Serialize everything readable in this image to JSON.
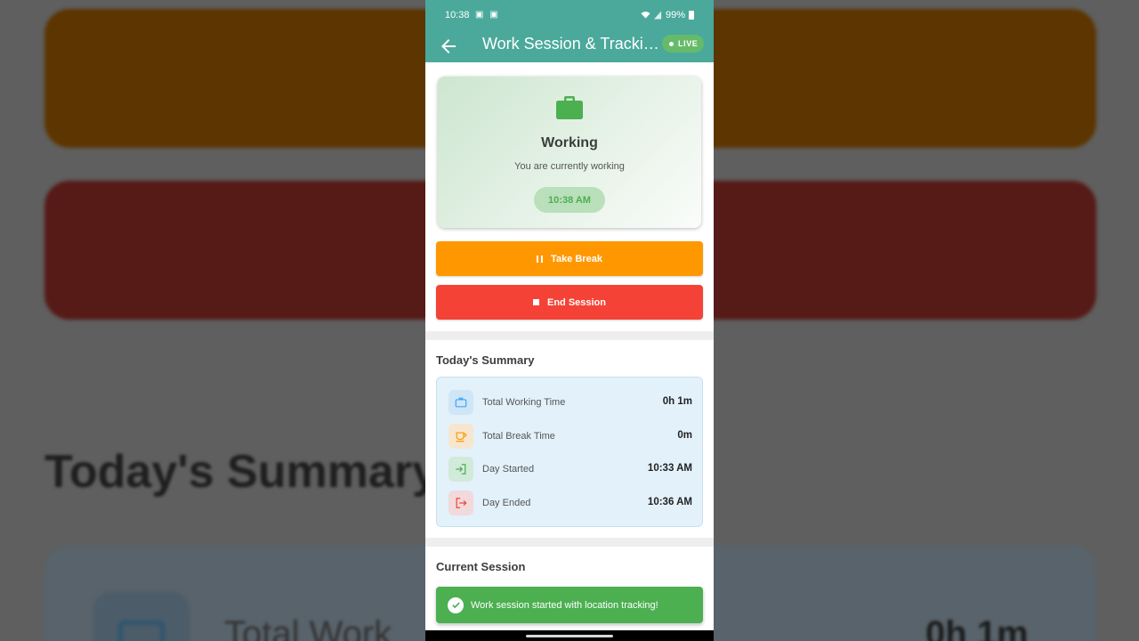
{
  "background": {
    "title": "Today's Summary",
    "row_label": "Total Work",
    "row_value": "0h 1m"
  },
  "status_bar": {
    "time": "10:38",
    "battery": "99%"
  },
  "app_bar": {
    "title": "Work Session & Tracking",
    "live_label": "LIVE"
  },
  "status_card": {
    "icon": "briefcase-icon",
    "title": "Working",
    "subtitle": "You are currently working",
    "time": "10:38 AM"
  },
  "actions": {
    "take_break": "Take Break",
    "end_session": "End Session"
  },
  "summary": {
    "title": "Today's Summary",
    "rows": [
      {
        "label": "Total Working Time",
        "value": "0h 1m",
        "icon": "briefcase-icon",
        "color": "#42a5f5"
      },
      {
        "label": "Total Break Time",
        "value": "0m",
        "icon": "coffee-icon",
        "color": "#ff9800"
      },
      {
        "label": "Day Started",
        "value": "10:33 AM",
        "icon": "login-icon",
        "color": "#4caf50"
      },
      {
        "label": "Day Ended",
        "value": "10:36 AM",
        "icon": "logout-icon",
        "color": "#f44336"
      }
    ]
  },
  "current_session": {
    "title": "Current Session"
  },
  "snackbar": {
    "message": "Work session started with location tracking!"
  },
  "colors": {
    "primary": "#4aa99b",
    "working": "#4caf50",
    "break": "#ff9800",
    "end": "#f44336",
    "summary_bg": "#e3f1fb"
  }
}
